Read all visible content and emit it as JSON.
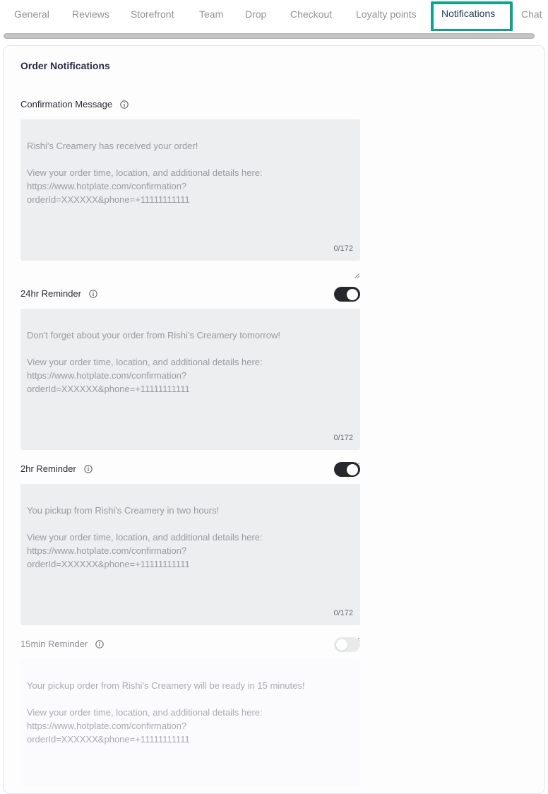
{
  "tabs": [
    {
      "label": "General",
      "active": false
    },
    {
      "label": "Reviews",
      "active": false
    },
    {
      "label": "Storefront",
      "active": false
    },
    {
      "label": "Team",
      "active": false
    },
    {
      "label": "Drop",
      "active": false
    },
    {
      "label": "Checkout",
      "active": false
    },
    {
      "label": "Loyalty points",
      "active": false
    },
    {
      "label": "Notifications",
      "active": true
    },
    {
      "label": "Chat",
      "active": false
    }
  ],
  "section": {
    "title": "Order Notifications"
  },
  "fields": {
    "confirmation": {
      "label": "Confirmation Message",
      "placeholder": "Rishi's Creamery has received your order!\n\nView your order time, location, and additional details here:\nhttps://www.hotplate.com/confirmation?\norderId=XXXXXX&phone=+11111111111",
      "count": "0/172"
    },
    "reminder_24hr": {
      "label": "24hr Reminder",
      "enabled": true,
      "placeholder": "Don't forget about your order from Rishi's Creamery tomorrow!\n\nView your order time, location, and additional details here:\nhttps://www.hotplate.com/confirmation?\norderId=XXXXXX&phone=+11111111111",
      "count": "0/172"
    },
    "reminder_2hr": {
      "label": "2hr Reminder",
      "enabled": true,
      "placeholder": "You pickup from Rishi's Creamery in two hours!\n\nView your order time, location, and additional details here:\nhttps://www.hotplate.com/confirmation?\norderId=XXXXXX&phone=+11111111111",
      "count": "0/172"
    },
    "reminder_15min": {
      "label": "15min Reminder",
      "enabled": false,
      "placeholder": "Your pickup order from Rishi's Creamery will be ready in 15 minutes!\n\nView your order time, location, and additional details here:\nhttps://www.hotplate.com/confirmation?\norderId=XXXXXX&phone=+11111111111"
    }
  },
  "icons": {
    "info": "info-icon",
    "resize": "resize-grip-icon"
  },
  "colors": {
    "highlight": "#0fa38f",
    "toggle_on": "#25282c",
    "toggle_off": "#e9eaec",
    "textarea_bg": "#eceeef"
  }
}
